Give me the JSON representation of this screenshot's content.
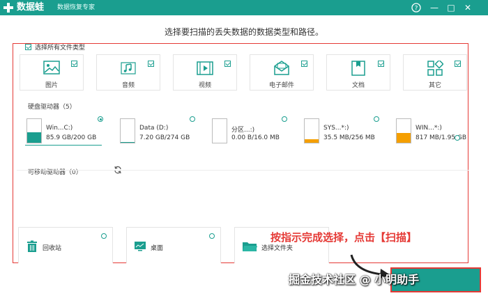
{
  "titlebar": {
    "app_name": "数据蛙",
    "subtitle": "数据恢复专家",
    "help": "?",
    "minimize": "—",
    "maximize": "□",
    "close": "✕"
  },
  "instruction": "选择要扫描的丢失数据的数据类型和路径。",
  "file_types": {
    "select_all_label": "选择所有文件类型",
    "items": [
      {
        "label": "图片",
        "icon": "image-icon",
        "checked": true
      },
      {
        "label": "音频",
        "icon": "music-icon",
        "checked": true
      },
      {
        "label": "视频",
        "icon": "video-icon",
        "checked": true
      },
      {
        "label": "电子邮件",
        "icon": "email-icon",
        "checked": true
      },
      {
        "label": "文档",
        "icon": "document-icon",
        "checked": true
      },
      {
        "label": "其它",
        "icon": "other-icon",
        "checked": true
      }
    ]
  },
  "hard_drives": {
    "header": "硬盘驱动器（5）",
    "items": [
      {
        "name": "Win...C:)",
        "size": "85.9 GB/200 GB",
        "selected": true,
        "fill_fraction": 0.43,
        "fill_color": "#1a9e8f"
      },
      {
        "name": "Data (D:)",
        "size": "7.20 GB/274 GB",
        "selected": false,
        "fill_fraction": 0.03,
        "fill_color": "#1a9e8f"
      },
      {
        "name": "分区...:)",
        "size": "0.00  B/16.0 MB",
        "selected": false,
        "fill_fraction": 0.0,
        "fill_color": "#f59f00"
      },
      {
        "name": "SYS...*:)",
        "size": "35.5 MB/256 MB",
        "selected": false,
        "fill_fraction": 0.14,
        "fill_color": "#f59f00"
      },
      {
        "name": "WIN...*:)",
        "size": "817 MB/1.95 GB",
        "selected": false,
        "fill_fraction": 0.42,
        "fill_color": "#f59f00"
      }
    ]
  },
  "removable": {
    "header": "可移动驱动器（0）"
  },
  "locations": [
    {
      "label": "回收站",
      "icon": "recycle-bin-icon"
    },
    {
      "label": "桌面",
      "icon": "desktop-icon"
    },
    {
      "label": "选择文件夹",
      "icon": "folder-icon"
    }
  ],
  "annotation": "按指示完成选择，点击【扫描】",
  "watermark": "掘金技术社区 @ 小明助手",
  "colors": {
    "accent": "#1a9e8f",
    "highlight": "#e53935",
    "warning": "#f59f00"
  }
}
